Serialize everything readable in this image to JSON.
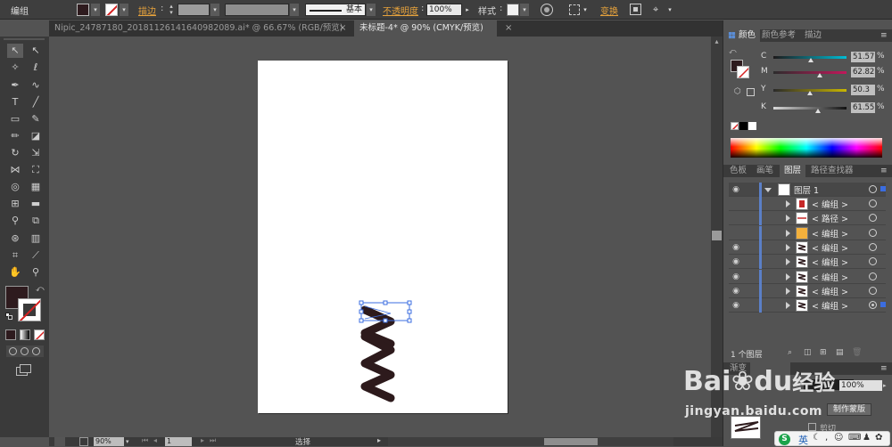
{
  "control_bar": {
    "selection_label": "编组",
    "stroke_label": "描边",
    "stroke_profile": "基本",
    "opacity_label": "不透明度",
    "opacity_value": "100%",
    "style_label": "样式",
    "transform_label": "变换"
  },
  "tabs": [
    {
      "label": "Nipic_24787180_20181126141640982089.ai* @ 66.67% (RGB/预览)",
      "active": false
    },
    {
      "label": "未标题-4* @ 90% (CMYK/预览)",
      "active": true
    }
  ],
  "tab_close": "×",
  "color_panel": {
    "tabs": [
      "颜色",
      "颜色参考",
      "描边"
    ],
    "channels": [
      {
        "label": "C",
        "value": "51.57",
        "pct": "%",
        "level": 0.5157,
        "gradient": "linear-gradient(to right,#1e1a1b,#00bcd4)"
      },
      {
        "label": "M",
        "value": "62.82",
        "pct": "%",
        "level": 0.6282,
        "gradient": "linear-gradient(to right,#2c2c2c,#c2185b)"
      },
      {
        "label": "Y",
        "value": "50.3",
        "pct": "%",
        "level": 0.503,
        "gradient": "linear-gradient(to right,#2a2a2a,#c9b600)"
      },
      {
        "label": "K",
        "value": "61.55",
        "pct": "%",
        "level": 0.6155,
        "gradient": "linear-gradient(to right,#d9d9d9,#111111)"
      }
    ]
  },
  "layers_panel": {
    "tabs": [
      "色板",
      "画笔",
      "图层",
      "路径查找器"
    ],
    "layer_name": "图层 1",
    "rows": [
      {
        "name": "< 编组 >",
        "eye": false,
        "thumb": "bag"
      },
      {
        "name": "< 路径 >",
        "eye": false,
        "thumb": "line"
      },
      {
        "name": "< 编组 >",
        "eye": false,
        "thumb": "orange"
      },
      {
        "name": "< 编组 >",
        "eye": true,
        "thumb": "spring"
      },
      {
        "name": "< 编组 >",
        "eye": true,
        "thumb": "spring"
      },
      {
        "name": "< 编组 >",
        "eye": true,
        "thumb": "spring"
      },
      {
        "name": "< 编组 >",
        "eye": true,
        "thumb": "spring"
      },
      {
        "name": "< 编组 >",
        "eye": true,
        "thumb": "spring",
        "selected": true
      }
    ],
    "footer_count": "1 个图层"
  },
  "transparency_panel": {
    "tab": "渐变",
    "opacity": "100%",
    "mask_button": "制作蒙版",
    "clip_label": "剪切"
  },
  "status_bar": {
    "zoom": "90%",
    "page": "1",
    "mode": "选择"
  },
  "watermark": {
    "brand": "Bai",
    "brand2": "du",
    "brand_cn": "经验",
    "url": "jingyan.baidu.com"
  },
  "ime": {
    "label": "英"
  },
  "colors": {
    "fill": "#2e1b1e",
    "spring": "#2d1a1c",
    "selection": "#3b6de0"
  }
}
